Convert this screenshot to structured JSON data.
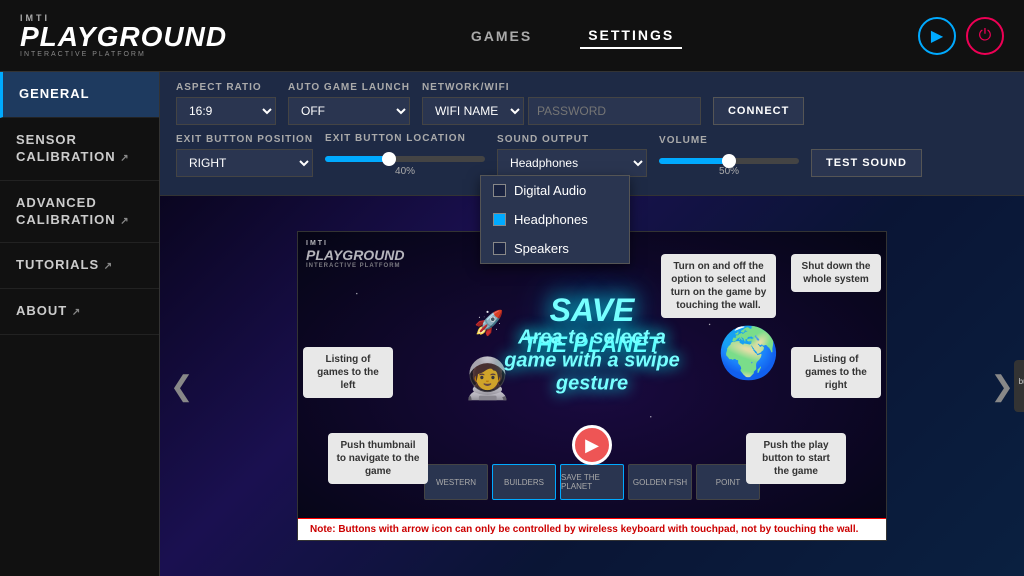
{
  "logo": {
    "imti": "IMTI",
    "main": "PLAYGROUND",
    "sub": "INTERACTIVE PLATFORM"
  },
  "nav": {
    "games_label": "GAMES",
    "settings_label": "SETTINGS",
    "play_icon": "▶",
    "power_icon": "⏻"
  },
  "sidebar": {
    "items": [
      {
        "label": "GENERAL",
        "active": true
      },
      {
        "label": "SENSOR\nCALIBRATION"
      },
      {
        "label": "ADVANCED\nCALIBRATION"
      },
      {
        "label": "TUTORIALS"
      },
      {
        "label": "ABOUT"
      }
    ]
  },
  "settings": {
    "aspect_ratio_label": "ASPECT RATIO",
    "aspect_ratio_value": "16:9",
    "auto_game_label": "AUTO GAME LAUNCH",
    "auto_game_value": "OFF",
    "network_label": "NETWORK/WIFI",
    "network_value": "WIFI NAME",
    "password_placeholder": "PASSWORD",
    "connect_label": "CONNECT",
    "exit_position_label": "EXIT BUTTON POSITION",
    "exit_position_value": "RIGHT",
    "exit_location_label": "EXIT BUTTON LOCATION",
    "exit_location_pct": "40%",
    "sound_output_label": "SOUND OUTPUT",
    "sound_output_value": "Headphones",
    "volume_label": "VOLUME",
    "volume_pct": "50%",
    "test_sound_label": "TEST SOUND",
    "dropdown_options": [
      {
        "label": "Digital Audio",
        "checked": false
      },
      {
        "label": "Headphones",
        "checked": true
      },
      {
        "label": "Speakers",
        "checked": false
      }
    ]
  },
  "preview": {
    "game_title": "SAVE",
    "game_subtitle": "THE PLANET",
    "watermark_imti": "IMTI",
    "watermark_main": "PLAYGROUND",
    "watermark_sub": "INTERACTIVE PLATFORM"
  },
  "tooltips": {
    "calibration": "Turn on and off the option to select and turn on the game by touching the wall.",
    "shutdown": "Shut down the whole system",
    "listing_left": "Listing of games to the left",
    "listing_right": "Listing of games to the right",
    "thumbnail": "Push thumbnail to navigate to the game",
    "play": "Push the play button to start the game",
    "swipe_area": "Area to select a game with a swipe gesture"
  },
  "note": {
    "text": "Note: Buttons with arrow icon  can only be controlled by wireless keyboard with touchpad, not by touching the wall."
  },
  "exit_hint": {
    "text": "exit button in the game"
  },
  "thumbs": [
    {
      "label": "WESTERN"
    },
    {
      "label": "BUILDERS"
    },
    {
      "label": "SAVE THE PLANET"
    },
    {
      "label": "GOLDEN FISH"
    },
    {
      "label": "POINT"
    }
  ]
}
